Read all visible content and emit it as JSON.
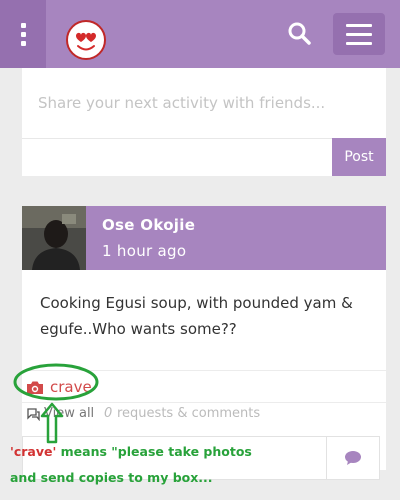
{
  "header": {
    "menu_icon": "vertical-dots-icon",
    "logo_icon": "heart-eyes-emoji-icon",
    "search_icon": "search-icon",
    "hamburger_icon": "hamburger-menu-icon",
    "bar_color": "#a785bf"
  },
  "share": {
    "placeholder": "Share your next activity with friends...",
    "post_label": "Post"
  },
  "post": {
    "author": "Ose Okojie",
    "time": "1 hour ago",
    "text": "Cooking Egusi soup, with pounded yam & egufe..Who wants some??",
    "crave_label": "crave",
    "crave_icon": "camera-icon",
    "view_all_label": "View all",
    "requests_count": "0",
    "requests_label": "requests & comments",
    "comment_icon": "speech-bubble-icon"
  },
  "annotation": {
    "quoted_word": "'crave'",
    "line1_rest": "means \"please take photos",
    "line2": "and send copies to my box..."
  }
}
